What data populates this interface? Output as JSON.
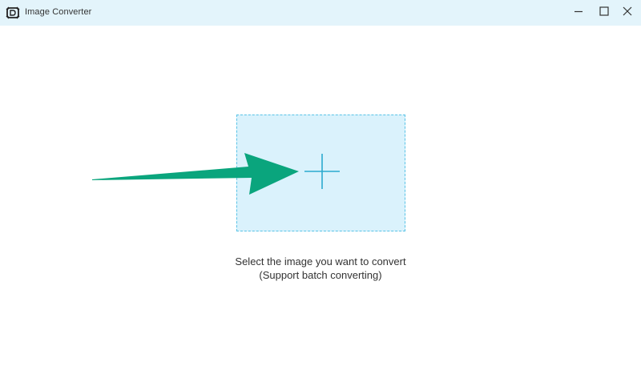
{
  "window": {
    "title": "Image Converter",
    "icons": {
      "app": "image-converter-app-icon",
      "minimize": "minimize-icon",
      "maximize": "maximize-icon",
      "close": "close-icon"
    }
  },
  "main": {
    "add_icon": "plus-icon",
    "prompt": "Select the image you want to convert",
    "note": "(Support batch converting)"
  },
  "colors": {
    "titlebar": "#e3f4fb",
    "drop_zone_fill": "#daf2fc",
    "drop_zone_border": "#59c3e6",
    "plus": "#2aa9cf",
    "arrow": "#0aa57d"
  }
}
